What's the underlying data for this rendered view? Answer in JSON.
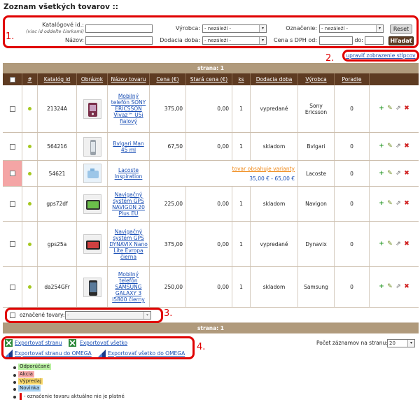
{
  "page": {
    "title": "Zoznam všetkých tovarov ::"
  },
  "markers": {
    "m1": "1.",
    "m2": "2.",
    "m3": "3.",
    "m4": "4."
  },
  "filter": {
    "catalog_label": "Katalógové id.:",
    "catalog_hint": "(viac id oddeľte čiarkami)",
    "name_label": "Názov:",
    "manufacturer_label": "Výrobca:",
    "manufacturer_value": "- nezáleží -",
    "delivery_label": "Dodacia doba:",
    "delivery_value": "- nezáleží -",
    "marking_label": "Označenie:",
    "marking_value": "- nezáleží -",
    "price_label": "Cena s DPH od:",
    "price_to_label": "do:",
    "reset_label": "Reset",
    "search_label": "Hľadať"
  },
  "column_adjust_label": "upraviť zobrazenie stĺpcov",
  "pager": {
    "label": "strana: 1"
  },
  "table": {
    "headers": [
      "#",
      "Katalóg id",
      "Obrázok",
      "Názov tovaru",
      "Cena (€)",
      "Stará cena (€)",
      "ks",
      "Dodacia doba",
      "Výrobca",
      "Poradie"
    ],
    "rows": [
      {
        "id": "21324A",
        "name": "Mobilný telefón SONY ERICSSON Vivaz™ U5i fialový",
        "price": "375,00",
        "old_price": "0,00",
        "qty": "1",
        "delivery": "vypredané",
        "maker": "Sony Ericsson",
        "order": "0"
      },
      {
        "id": "564216",
        "name": "Bvlgari Man 45 ml",
        "price": "67,50",
        "old_price": "0,00",
        "qty": "1",
        "delivery": "skladom",
        "maker": "Bvlgari",
        "order": "0"
      },
      {
        "id": "54621",
        "name": "Lacoste Inspiration",
        "variant_note": "tovar obsahuje varianty",
        "variant_range": "35,00 € - 65,00 €",
        "maker": "Lacoste",
        "order": "0"
      },
      {
        "id": "gps72df",
        "name": "Navigačný systém GPS NAVIGON 20 Plus EU",
        "price": "225,00",
        "old_price": "0,00",
        "qty": "1",
        "delivery": "skladom",
        "maker": "Navigon",
        "order": "0"
      },
      {
        "id": "gps25a",
        "name": "Navigačný systém GPS DYNAVIX Nano Lite Evropa čierna",
        "price": "375,00",
        "old_price": "0,00",
        "qty": "1",
        "delivery": "vypredané",
        "maker": "Dynavix",
        "order": "0"
      },
      {
        "id": "da254GFr",
        "name": "Mobilný telefón SAMSUNG GALAXY 3 I5800 čierny",
        "price": "250,00",
        "old_price": "0,00",
        "qty": "1",
        "delivery": "skladom",
        "maker": "Samsung",
        "order": "0"
      }
    ]
  },
  "bulk": {
    "label": "označené tovary:",
    "select_value": "-"
  },
  "export": {
    "page": "Exportovať stranu",
    "all": "Exportovať všetko",
    "page_omega": "Exportovať stranu do OMEGA",
    "all_omega": "Exportovať všetko do OMEGA"
  },
  "per_page": {
    "label": "Počet záznamov na stranu:",
    "value": "20"
  },
  "legend": {
    "recommended": "Odporúčané",
    "action": "Akcia",
    "sale": "Výpredaj",
    "new": "Novinka",
    "invalid_note": "- označenie tovaru aktuálne nie je platné"
  },
  "colors": {
    "recommended": "#b8f0a0",
    "action": "#f7a8a8",
    "sale": "#f8d86a",
    "new": "#a8d4f5",
    "header": "#5e3b22",
    "bar": "#b09a7c",
    "highlight": "#e00000"
  },
  "icons": [
    "add-icon",
    "edit-icon",
    "open-icon",
    "delete-icon",
    "excel-icon",
    "omega-icon"
  ]
}
